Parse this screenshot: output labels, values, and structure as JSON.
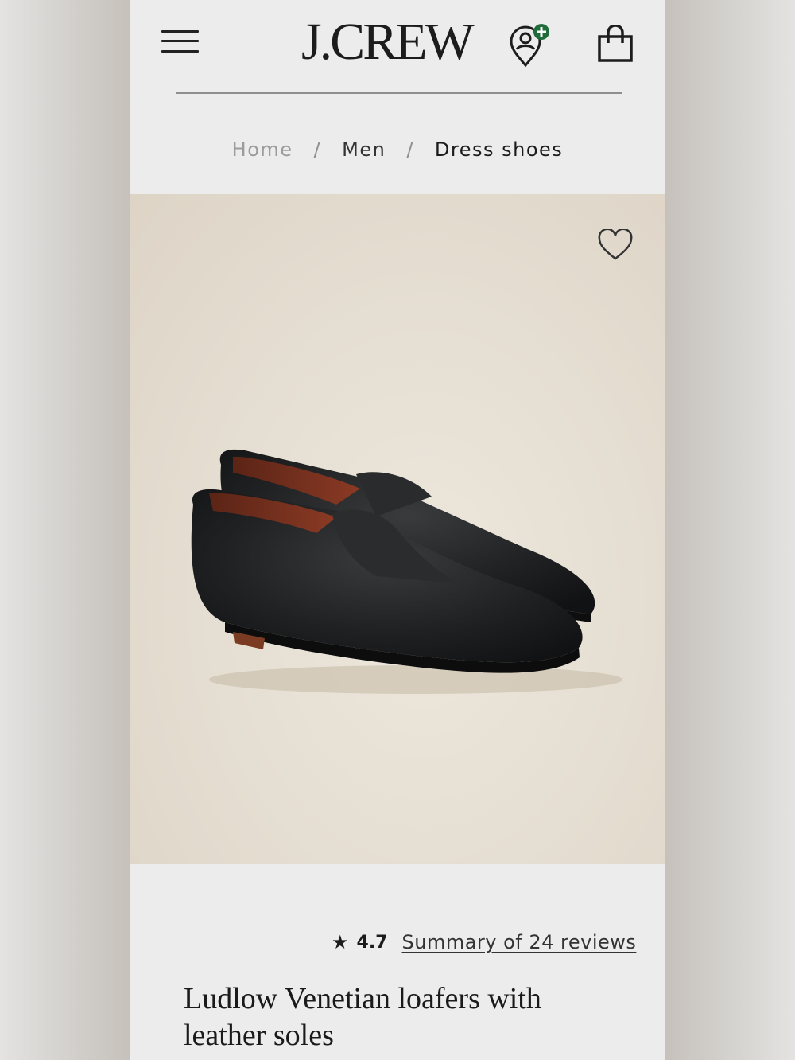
{
  "header": {
    "logo_text": "J.CREW",
    "menu_icon": "hamburger-menu-icon",
    "location_icon": "location-pin-add-icon",
    "bag_icon": "shopping-bag-icon",
    "accent_color": "#1f6b3a"
  },
  "breadcrumb": {
    "items": [
      "Home",
      "Men",
      "Dress shoes"
    ],
    "separator": "/"
  },
  "product": {
    "image_alt": "Black pebbled leather loafers",
    "favorite_icon": "heart-outline-icon",
    "rating": "4.7",
    "rating_icon": "star-icon",
    "reviews_link": "Summary of 24 reviews",
    "title": "Ludlow Venetian loafers with leather soles"
  }
}
